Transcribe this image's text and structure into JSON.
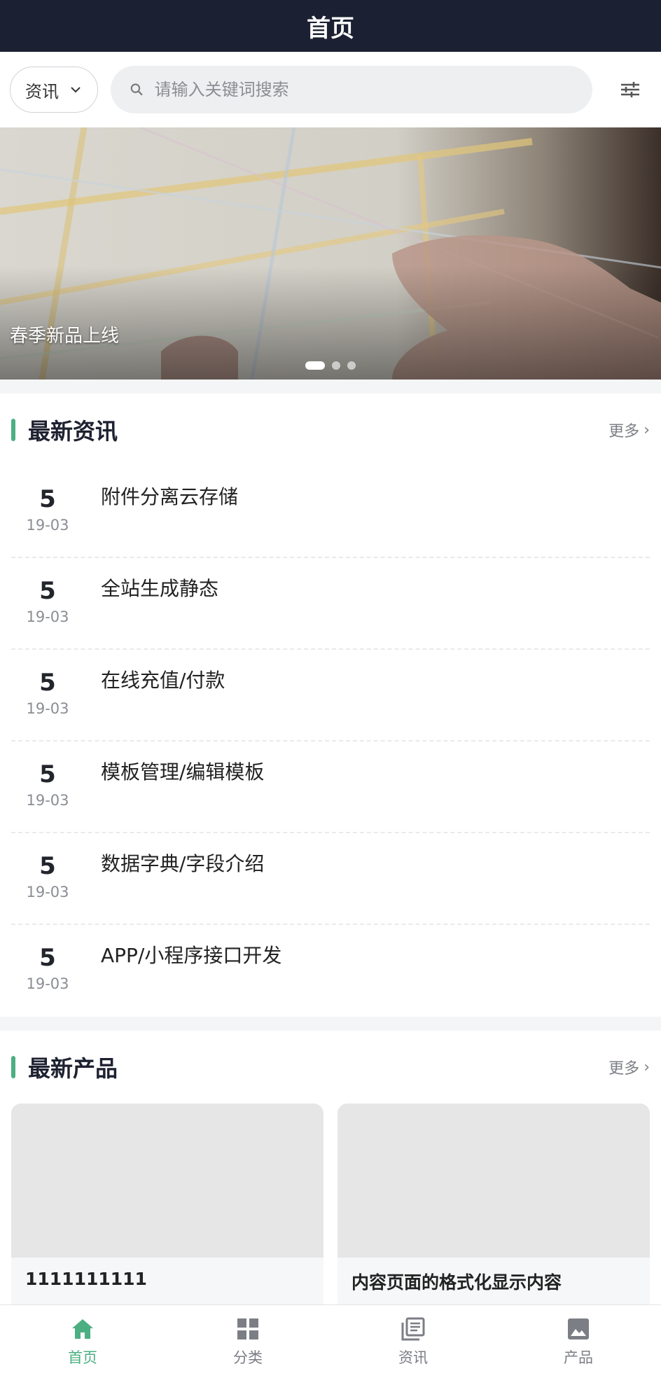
{
  "header": {
    "title": "首页"
  },
  "search": {
    "category": "资讯",
    "placeholder": "请输入关键词搜索"
  },
  "banner": {
    "caption": "春季新品上线",
    "slide_count": 3,
    "active_index": 0
  },
  "news": {
    "title": "最新资讯",
    "more": "更多",
    "items": [
      {
        "day": "5",
        "ym": "19-03",
        "title": "附件分离云存储"
      },
      {
        "day": "5",
        "ym": "19-03",
        "title": "全站生成静态"
      },
      {
        "day": "5",
        "ym": "19-03",
        "title": "在线充值/付款"
      },
      {
        "day": "5",
        "ym": "19-03",
        "title": "模板管理/编辑模板"
      },
      {
        "day": "5",
        "ym": "19-03",
        "title": "数据字典/字段介绍"
      },
      {
        "day": "5",
        "ym": "19-03",
        "title": "APP/小程序接口开发"
      }
    ]
  },
  "products": {
    "title": "最新产品",
    "more": "更多",
    "items": [
      {
        "title": "1111111111"
      },
      {
        "title": "内容页面的格式化显示内容"
      }
    ]
  },
  "tabbar": {
    "items": [
      {
        "label": "首页",
        "icon": "home-icon",
        "active": true
      },
      {
        "label": "分类",
        "icon": "grid-icon",
        "active": false
      },
      {
        "label": "资讯",
        "icon": "news-icon",
        "active": false
      },
      {
        "label": "产品",
        "icon": "image-icon",
        "active": false
      }
    ]
  },
  "colors": {
    "accent": "#4caf82",
    "header_bg": "#1b2132"
  }
}
